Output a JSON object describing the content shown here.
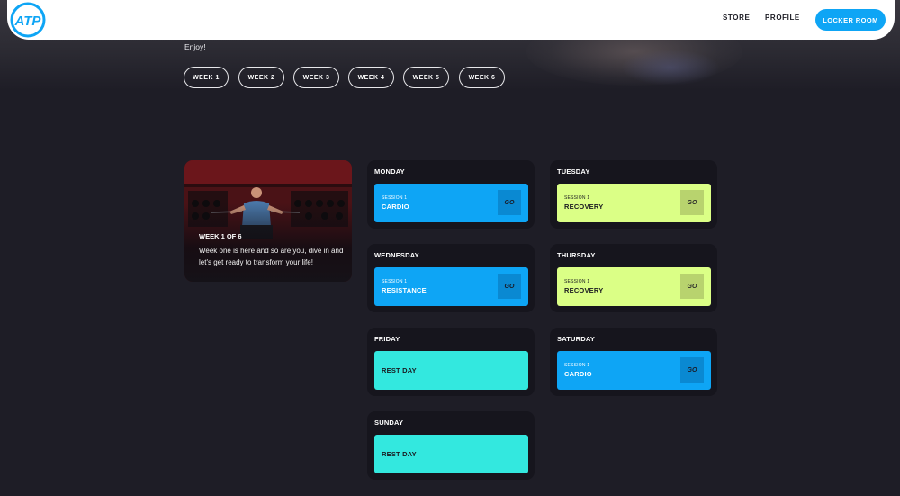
{
  "brand": {
    "logo_text": "ATP"
  },
  "nav": {
    "store": "STORE",
    "profile": "PROFILE",
    "locker_room": "LOCKER ROOM"
  },
  "hero": {
    "enjoy": "Enjoy!"
  },
  "week_tabs": [
    "WEEK 1",
    "WEEK 2",
    "WEEK 3",
    "WEEK 4",
    "WEEK 5",
    "WEEK 6"
  ],
  "intro": {
    "week_label": "WEEK 1 OF 6",
    "text": "Week one is here and so are you, dive in and let's get ready to transform your life!"
  },
  "days": {
    "monday": {
      "name": "MONDAY",
      "session_label": "SESSION 1",
      "type": "CARDIO",
      "go": "GO"
    },
    "tuesday": {
      "name": "TUESDAY",
      "session_label": "SESSION 1",
      "type": "RECOVERY",
      "go": "GO"
    },
    "wednesday": {
      "name": "WEDNESDAY",
      "session_label": "SESSION 1",
      "type": "RESISTANCE",
      "go": "GO"
    },
    "thursday": {
      "name": "THURSDAY",
      "session_label": "SESSION 1",
      "type": "RECOVERY",
      "go": "GO"
    },
    "friday": {
      "name": "FRIDAY",
      "rest": "REST DAY"
    },
    "saturday": {
      "name": "SATURDAY",
      "session_label": "SESSION 1",
      "type": "CARDIO",
      "go": "GO"
    },
    "sunday": {
      "name": "SUNDAY",
      "rest": "REST DAY"
    }
  },
  "colors": {
    "background": "#1e1d26",
    "card": "#16151d",
    "accent_blue": "#0ea5f5",
    "recovery_green": "#dbff86",
    "rest_cyan": "#33e8df"
  }
}
